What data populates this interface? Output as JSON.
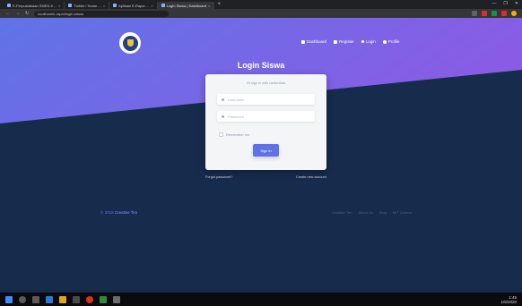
{
  "browser": {
    "tabs": [
      {
        "label": "E-Perpustakaan SMKN 8 ..."
      },
      {
        "label": "Twitter / Home ..."
      },
      {
        "label": "Aplikasi E-Rapor ..."
      },
      {
        "label": "Login Siswa | Dashboard",
        "active": true
      }
    ],
    "new_tab": "+",
    "address": "localhost/e-rapor/login-siswa",
    "window_controls": [
      "—",
      "❐",
      "✕"
    ]
  },
  "page": {
    "nav": [
      {
        "label": "Dashboard",
        "icon": "planet-icon"
      },
      {
        "label": "Register",
        "icon": "circle-icon"
      },
      {
        "label": "Login",
        "icon": "key-icon"
      },
      {
        "label": "Profile",
        "icon": "user-icon"
      }
    ],
    "title": "Login Siswa",
    "card": {
      "subtitle": "Or sign in with credentials",
      "username_placeholder": "Username",
      "password_placeholder": "Password",
      "remember_label": "Remember me",
      "signin_label": "Sign in"
    },
    "links": {
      "forgot": "Forgot password?",
      "create": "Create new account"
    },
    "footer": {
      "copyright_prefix": "© 2018",
      "brand": "Creative Tim",
      "links": [
        "Creative Tim",
        "About Us",
        "Blog",
        "MIT License"
      ]
    }
  },
  "taskbar": {
    "time": "1:45",
    "date": "1/8/2020"
  },
  "colors": {
    "hero_start": "#5e72e4",
    "hero_end": "#825ee4",
    "background": "#172b4d",
    "primary_button": "#5e72e4",
    "card": "#f4f5f7"
  }
}
